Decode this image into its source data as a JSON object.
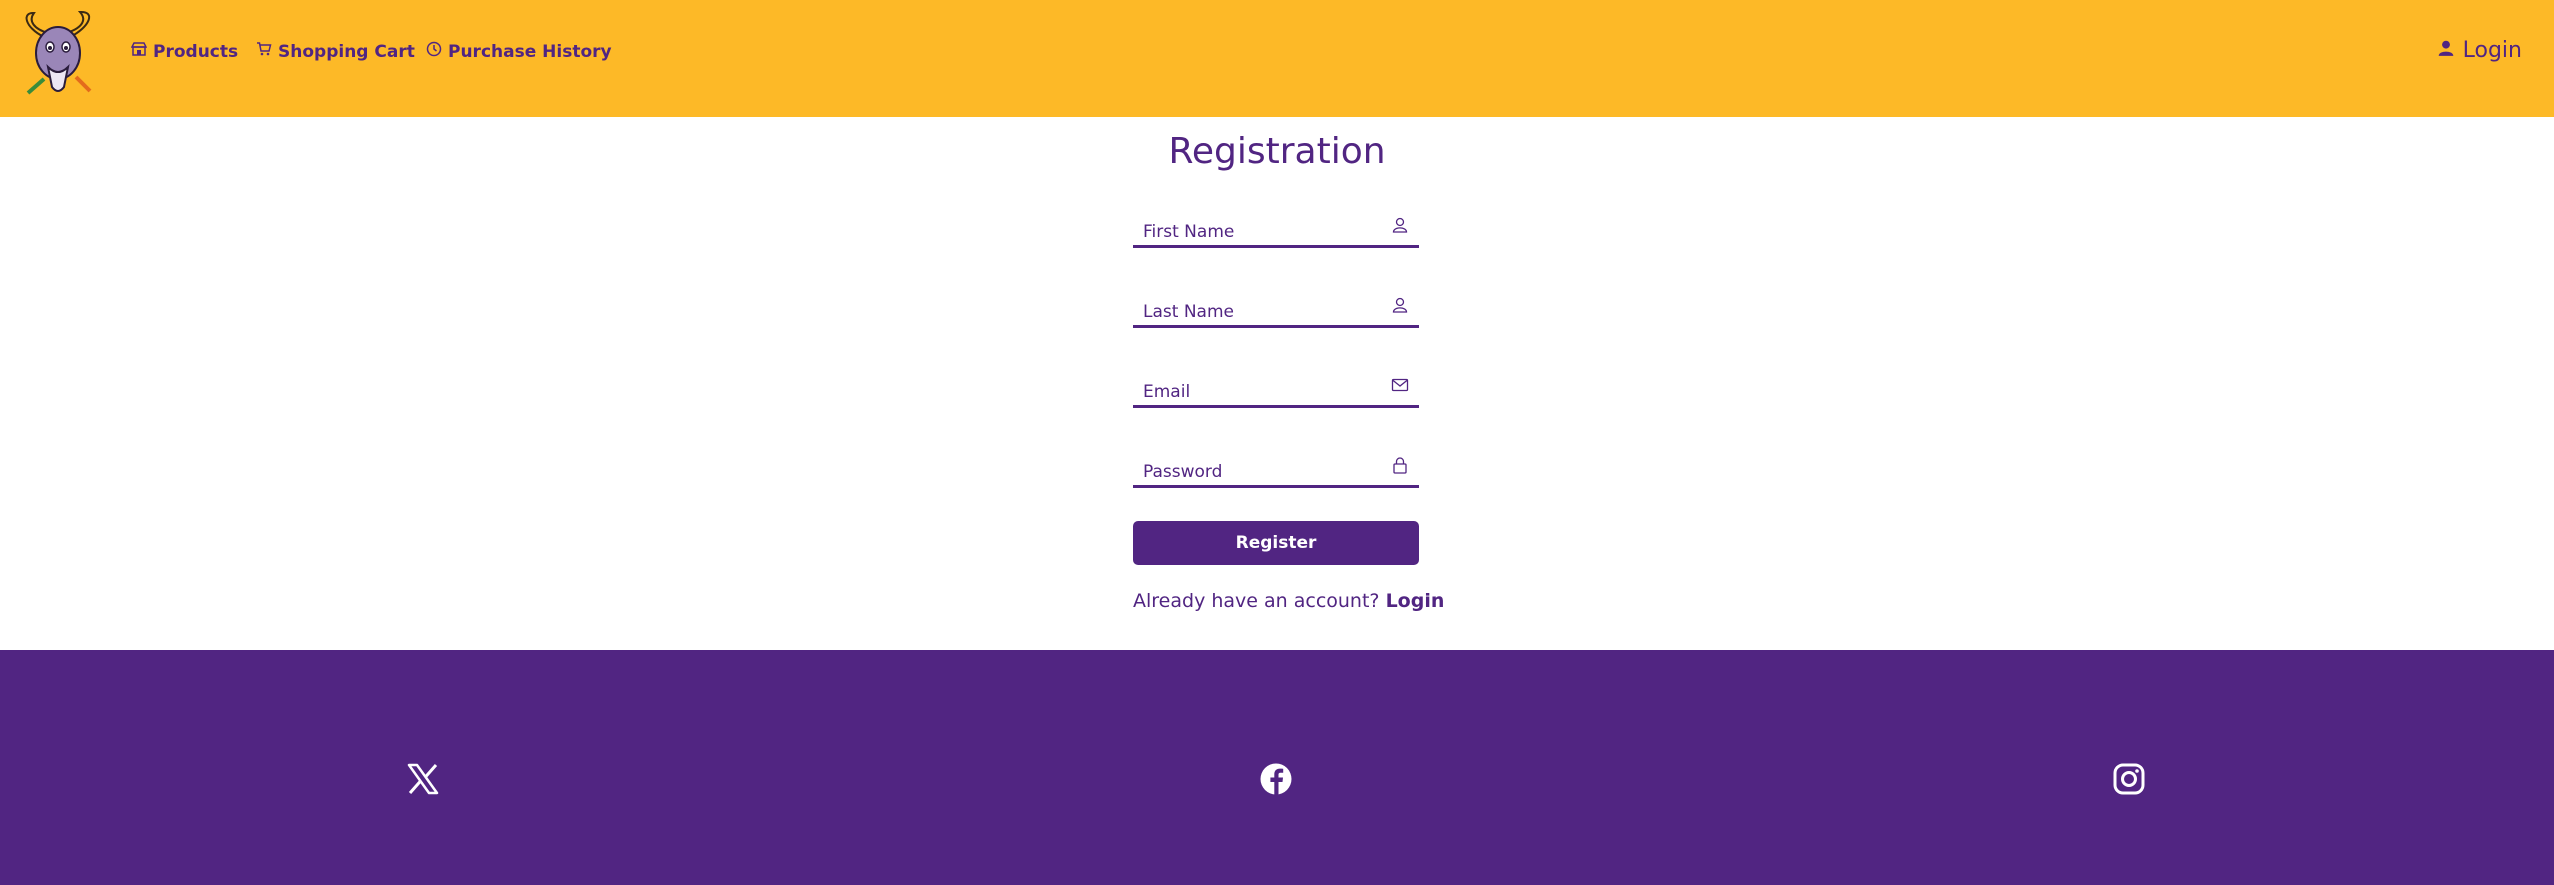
{
  "header": {
    "logo_alt": "Goat mascot logo",
    "nav": [
      {
        "label": "Products",
        "icon": "storefront-icon"
      },
      {
        "label": "Shopping Cart",
        "icon": "cart-icon"
      },
      {
        "label": "Purchase History",
        "icon": "clock-icon"
      }
    ],
    "login_label": "Login"
  },
  "form": {
    "title": "Registration",
    "fields": [
      {
        "placeholder": "First Name",
        "value": "",
        "icon": "user-icon"
      },
      {
        "placeholder": "Last Name",
        "value": "",
        "icon": "user-icon"
      },
      {
        "placeholder": "Email",
        "value": "",
        "icon": "mail-icon"
      },
      {
        "placeholder": "Password",
        "value": "",
        "icon": "lock-icon"
      }
    ],
    "register_label": "Register",
    "login_prompt": "Already have an account?",
    "login_link": "Login"
  },
  "footer": {
    "social": [
      {
        "name": "x-icon"
      },
      {
        "name": "facebook-icon"
      },
      {
        "name": "instagram-icon"
      }
    ]
  },
  "colors": {
    "header_bg": "#fdb927",
    "primary": "#512582",
    "background": "#ffffff"
  }
}
